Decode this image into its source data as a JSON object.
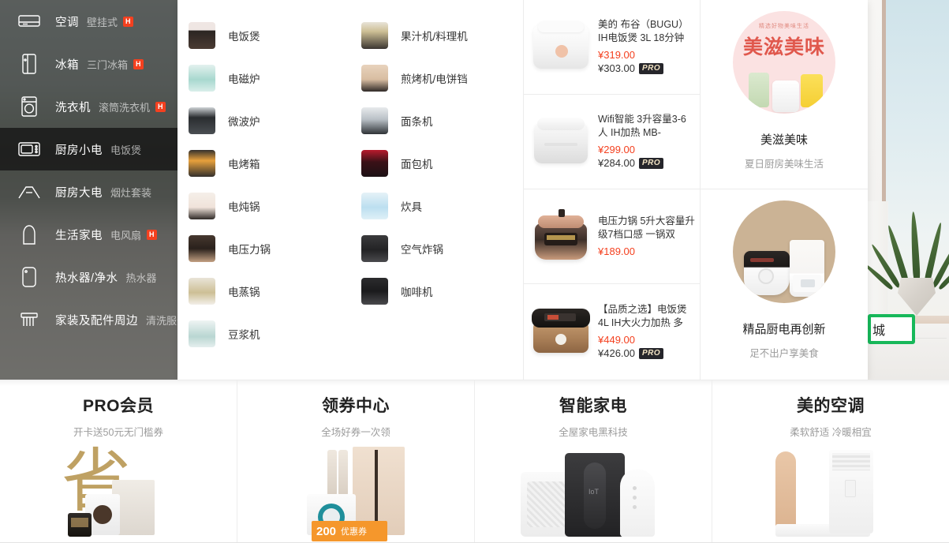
{
  "sidebar": {
    "items": [
      {
        "name": "空调",
        "sub": "壁挂式",
        "hot": "H",
        "icon": "air-conditioner-icon",
        "active": false
      },
      {
        "name": "冰箱",
        "sub": "三门冰箱",
        "hot": "H",
        "icon": "refrigerator-icon",
        "active": false
      },
      {
        "name": "洗衣机",
        "sub": "滚筒洗衣机",
        "hot": "H",
        "icon": "washing-machine-icon",
        "active": false
      },
      {
        "name": "厨房小电",
        "sub": "电饭煲",
        "hot": "",
        "icon": "microwave-icon",
        "active": true
      },
      {
        "name": "厨房大电",
        "sub": "烟灶套装",
        "hot": "",
        "icon": "range-hood-icon",
        "active": false
      },
      {
        "name": "生活家电",
        "sub": "电风扇",
        "hot": "H",
        "icon": "kettle-icon",
        "active": false
      },
      {
        "name": "热水器/净水",
        "sub": "热水器",
        "hot": "",
        "icon": "water-heater-icon",
        "active": false
      },
      {
        "name": "家装及配件周边",
        "sub": "清洗服务",
        "hot": "",
        "icon": "fixture-icon",
        "active": false
      }
    ]
  },
  "mega": {
    "subcategories_col1": [
      {
        "label": "电饭煲",
        "icon": "rice-cooker-icon"
      },
      {
        "label": "电磁炉",
        "icon": "induction-cooker-icon"
      },
      {
        "label": "微波炉",
        "icon": "microwave-oven-icon"
      },
      {
        "label": "电烤箱",
        "icon": "electric-oven-icon"
      },
      {
        "label": "电炖锅",
        "icon": "stew-pot-icon"
      },
      {
        "label": "电压力锅",
        "icon": "pressure-cooker-icon"
      },
      {
        "label": "电蒸锅",
        "icon": "steamer-icon"
      },
      {
        "label": "豆浆机",
        "icon": "soymilk-maker-icon"
      }
    ],
    "subcategories_col2": [
      {
        "label": "果汁机/料理机",
        "icon": "blender-icon"
      },
      {
        "label": "煎烤机/电饼铛",
        "icon": "griddle-icon"
      },
      {
        "label": "面条机",
        "icon": "noodle-maker-icon"
      },
      {
        "label": "面包机",
        "icon": "bread-maker-icon"
      },
      {
        "label": "炊具",
        "icon": "cookware-icon"
      },
      {
        "label": "空气炸锅",
        "icon": "air-fryer-icon"
      },
      {
        "label": "咖啡机",
        "icon": "coffee-machine-icon"
      }
    ],
    "products": [
      {
        "title": "美的 布谷（BUGU）IH电饭煲 3L 18分钟",
        "price": "¥319.00",
        "pro_price": "¥303.00",
        "pro_badge": "PRO",
        "image": "white-rice-cooker"
      },
      {
        "title": "Wifi智能 3升容量3-6人 IH加热 MB-",
        "price": "¥299.00",
        "pro_price": "¥284.00",
        "pro_badge": "PRO",
        "image": "silver-rice-cooker"
      },
      {
        "title": "电压力锅 5升大容量升级7档口感 一锅双",
        "price": "¥189.00",
        "pro_price": "",
        "pro_badge": "",
        "image": "rose-pressure-cooker"
      },
      {
        "title": "【品质之选】电饭煲 4L IH大火力加热 多",
        "price": "¥449.00",
        "pro_price": "¥426.00",
        "pro_badge": "PRO",
        "image": "black-gold-rice-cooker"
      }
    ],
    "promos": [
      {
        "brand_arc": "精选好物美味生活",
        "brand_word": "美滋美味",
        "title": "美滋美味",
        "sub": "夏日厨房美味生活",
        "circle_color": "#fbe2e2"
      },
      {
        "brand_arc": "",
        "brand_word": "",
        "title": "精品厨电再创新",
        "sub": "足不出户享美食",
        "circle_color": "#cbb395"
      }
    ]
  },
  "banners": [
    {
      "title": "PRO会员",
      "sub": "开卡送50元无门槛券",
      "art": "sheng-character",
      "coupon_value": ""
    },
    {
      "title": "领券中心",
      "sub": "全场好券一次领",
      "art": "coupon-appliances",
      "coupon_value": "200",
      "coupon_label": "优惠券"
    },
    {
      "title": "智能家电",
      "sub": "全屋家电黑科技",
      "art": "smart-appliances",
      "coupon_value": ""
    },
    {
      "title": "美的空调",
      "sub": "柔软舒适 冷暖相宜",
      "art": "air-conditioners",
      "coupon_value": ""
    }
  ],
  "hero": {
    "cta_text": "城"
  },
  "colors": {
    "accent_red": "#f4401f",
    "pro_badge_bg": "#26262b",
    "pro_badge_fg": "#f3e4c4",
    "cta_green": "#17b85a"
  }
}
